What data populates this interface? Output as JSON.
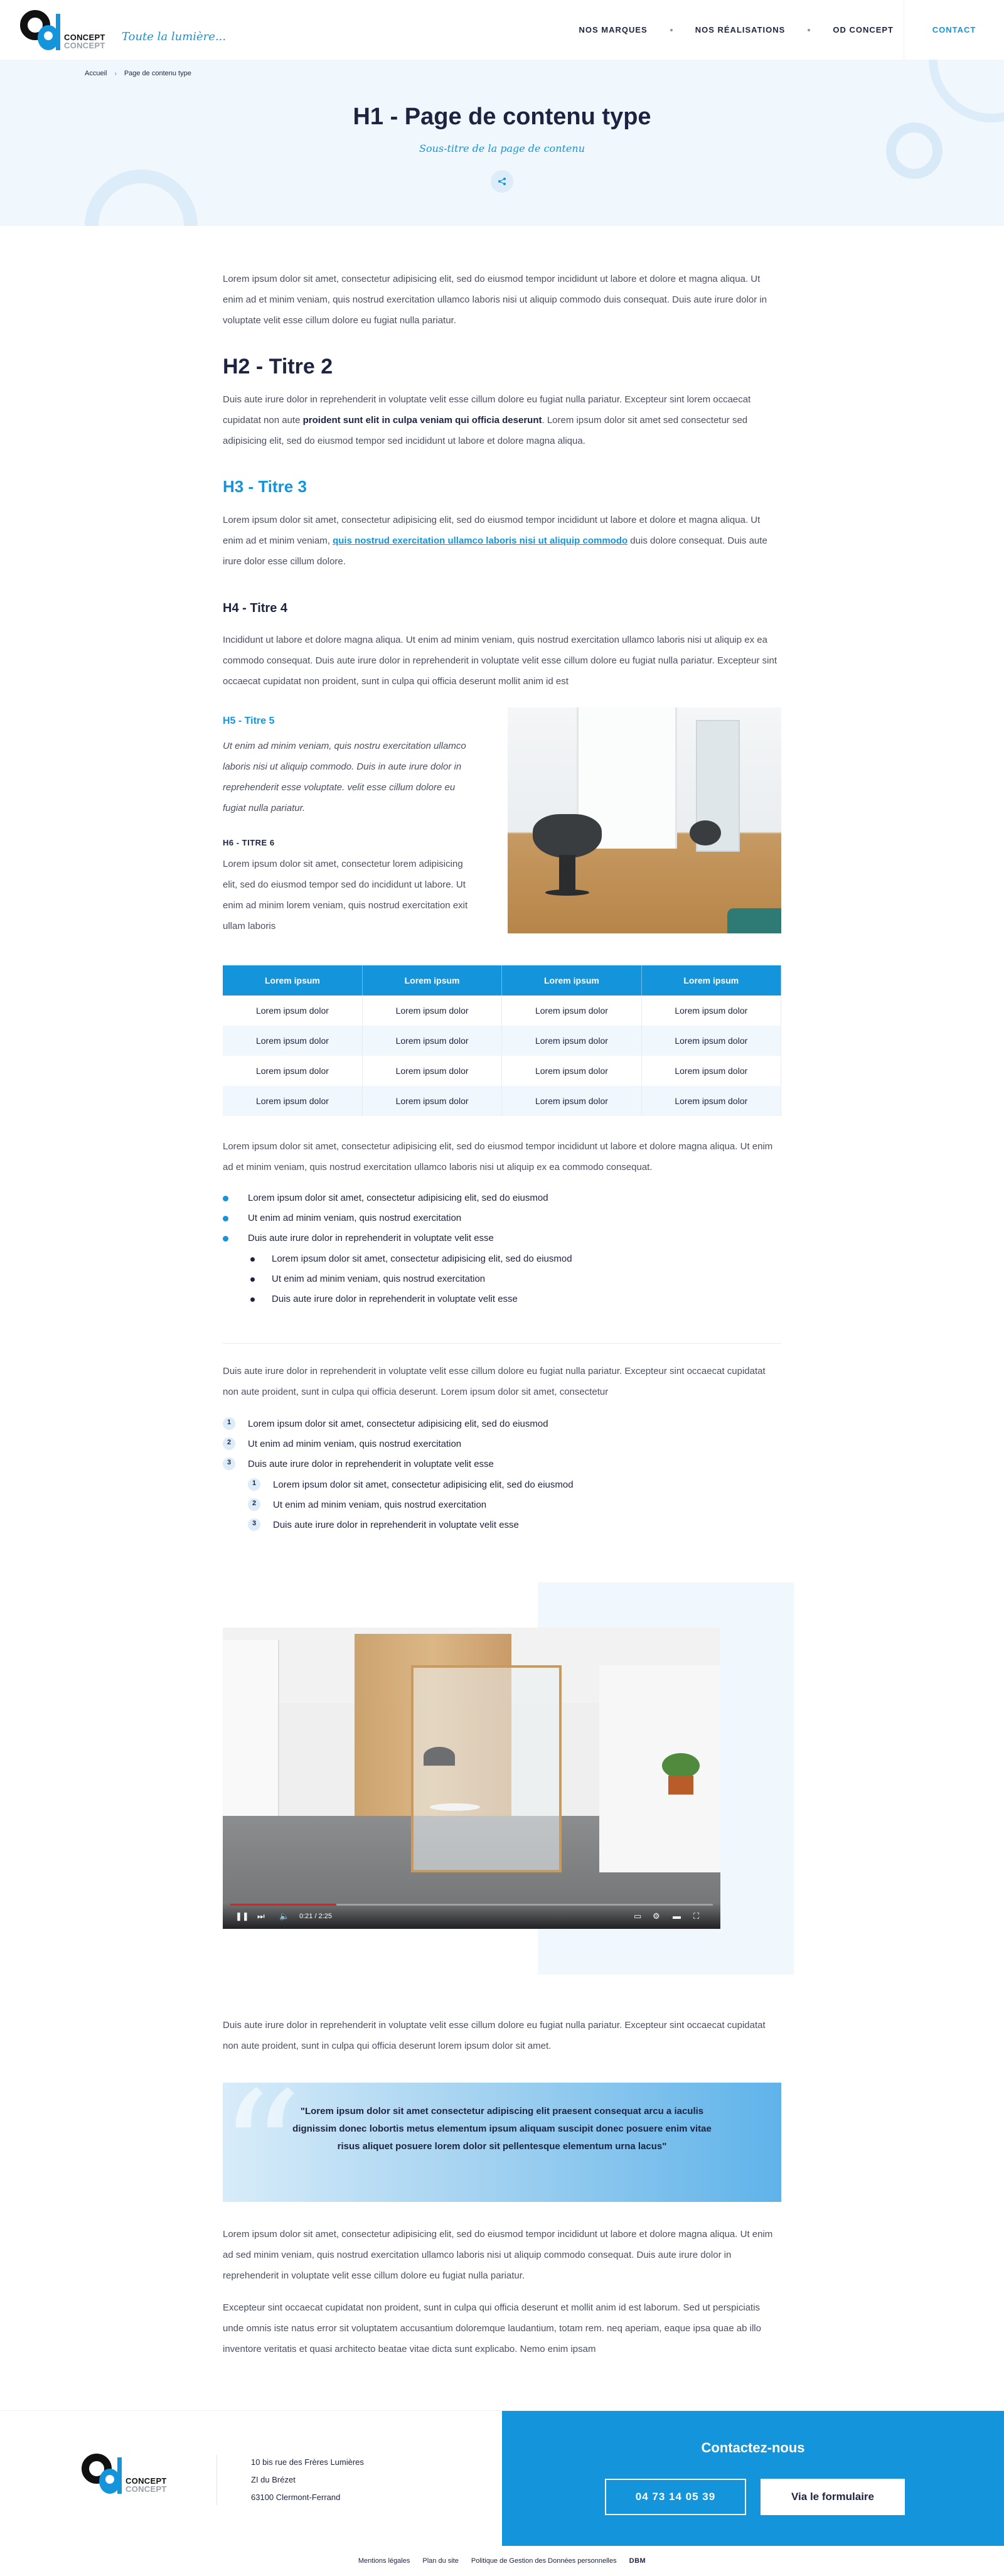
{
  "header": {
    "logo_word1": "CONCEPT",
    "logo_word2": "CONCEPT",
    "tagline": "Toute la lumière...",
    "nav": [
      "NOS MARQUES",
      "NOS RÉALISATIONS",
      "OD CONCEPT"
    ],
    "contact": "CONTACT"
  },
  "breadcrumb": [
    "Accueil",
    "Page de contenu type"
  ],
  "hero": {
    "title": "H1 - Page de contenu type",
    "subtitle": "Sous-titre de la page de contenu"
  },
  "content": {
    "intro": "Lorem ipsum dolor sit amet, consectetur adipisicing elit, sed do eiusmod tempor incididunt ut labore et dolore et magna aliqua. Ut enim ad et minim veniam, quis nostrud exercitation ullamco laboris nisi ut aliquip commodo duis consequat. Duis aute irure dolor in voluptate velit esse cillum dolore eu fugiat nulla pariatur.",
    "h2": "H2 - Titre 2",
    "p2_a": "Duis aute irure dolor in reprehenderit in voluptate velit esse cillum dolore eu fugiat nulla pariatur. Excepteur sint lorem occaecat cupidatat non aute ",
    "p2_bold": "proident sunt elit in culpa veniam qui officia deserunt",
    "p2_b": ". Lorem ipsum dolor sit amet sed consectetur sed adipisicing elit, sed do eiusmod tempor sed incididunt ut labore et dolore magna aliqua.",
    "h3": "H3 - Titre 3",
    "p3_a": "Lorem ipsum dolor sit amet, consectetur adipisicing elit, sed do eiusmod tempor incididunt ut labore et dolore et magna aliqua. Ut enim ad et minim veniam, ",
    "p3_link": "quis nostrud exercitation ullamco laboris nisi ut aliquip commodo",
    "p3_b": " duis dolore consequat. Duis aute irure dolor esse cillum dolore.",
    "h4": "H4 - Titre 4",
    "p4": "Incididunt ut labore et dolore magna aliqua. Ut enim ad minim veniam, quis nostrud exercitation ullamco laboris nisi ut aliquip ex ea commodo consequat. Duis aute irure dolor in reprehenderit in voluptate velit esse cillum dolore eu fugiat nulla pariatur. Excepteur sint occaecat cupidatat non proident, sunt in culpa qui officia deserunt mollit anim id est",
    "h5": "H5 - Titre 5",
    "p5": "Ut enim ad minim veniam, quis nostru exercitation ullamco laboris nisi ut aliquip commodo. Duis in aute irure dolor in reprehenderit esse voluptate. velit esse cillum dolore eu fugiat nulla pariatur.",
    "h6": "H6 - TITRE 6",
    "p6": "Lorem ipsum dolor sit amet, consectetur lorem adipisicing elit, sed do eiusmod tempor sed do incididunt ut labore. Ut enim ad minim lorem veniam, quis nostrud exercitation exit ullam laboris"
  },
  "table": {
    "headers": [
      "Lorem ipsum",
      "Lorem ipsum",
      "Lorem ipsum",
      "Lorem ipsum"
    ],
    "rows": [
      [
        "Lorem ipsum dolor",
        "Lorem ipsum dolor",
        "Lorem ipsum dolor",
        "Lorem ipsum dolor"
      ],
      [
        "Lorem ipsum dolor",
        "Lorem ipsum dolor",
        "Lorem ipsum dolor",
        "Lorem ipsum dolor"
      ],
      [
        "Lorem ipsum dolor",
        "Lorem ipsum dolor",
        "Lorem ipsum dolor",
        "Lorem ipsum dolor"
      ],
      [
        "Lorem ipsum dolor",
        "Lorem ipsum dolor",
        "Lorem ipsum dolor",
        "Lorem ipsum dolor"
      ]
    ]
  },
  "lists": {
    "ul_intro": "Lorem ipsum dolor sit amet, consectetur adipisicing elit, sed do eiusmod tempor incididunt ut labore et dolore magna aliqua. Ut enim ad et minim veniam, quis nostrud exercitation ullamco laboris nisi ut aliquip ex ea commodo consequat.",
    "ul": [
      "Lorem ipsum dolor sit amet, consectetur adipisicing elit, sed do eiusmod",
      "Ut enim ad minim veniam, quis nostrud exercitation",
      "Duis aute irure dolor in reprehenderit in voluptate velit esse"
    ],
    "ul_sub": [
      "Lorem ipsum dolor sit amet, consectetur adipisicing elit, sed do eiusmod",
      "Ut enim ad minim veniam, quis nostrud exercitation",
      "Duis aute irure dolor in reprehenderit in voluptate velit esse"
    ],
    "ol_intro": "Duis aute irure dolor in reprehenderit in voluptate velit esse cillum dolore eu fugiat nulla pariatur. Excepteur sint occaecat cupidatat non aute proident, sunt in culpa qui officia deserunt. Lorem ipsum dolor sit amet, consectetur",
    "ol": [
      "Lorem ipsum dolor sit amet, consectetur adipisicing elit, sed do eiusmod",
      "Ut enim ad minim veniam, quis nostrud exercitation",
      "Duis aute irure dolor in reprehenderit in voluptate velit esse"
    ],
    "ol_nums": [
      "1",
      "2",
      "3"
    ],
    "ol_sub": [
      "Lorem ipsum dolor sit amet, consectetur adipisicing elit, sed do eiusmod",
      "Ut enim ad minim veniam, quis nostrud exercitation",
      "Duis aute irure dolor in reprehenderit in voluptate velit esse"
    ]
  },
  "video": {
    "time": "0:21 / 2:25",
    "progress": 0.22
  },
  "after_video": "Duis aute irure dolor in reprehenderit in voluptate velit esse cillum dolore eu fugiat nulla pariatur. Excepteur sint occaecat cupidatat non aute proident, sunt in culpa qui officia deserunt lorem ipsum dolor sit amet.",
  "quote": "\"Lorem ipsum dolor sit amet consectetur adipiscing elit praesent consequat arcu a iaculis dignissim donec lobortis metus elementum ipsum aliquam suscipit donec posuere enim vitae risus aliquet posuere lorem dolor sit pellentesque elementum urna lacus\"",
  "closing": {
    "p1": "Lorem ipsum dolor sit amet, consectetur adipisicing elit, sed do eiusmod tempor incididunt ut labore et dolore magna aliqua. Ut enim ad sed minim veniam, quis nostrud exercitation ullamco laboris nisi ut aliquip commodo consequat. Duis aute irure dolor in reprehenderit in voluptate velit esse cillum dolore eu fugiat nulla pariatur.",
    "p2": "Excepteur sint occaecat cupidatat non proident, sunt in culpa qui officia deserunt et mollit anim id est laborum. Sed ut perspiciatis unde omnis iste natus error sit voluptatem accusantium doloremque laudantium, totam rem. neq aperiam, eaque ipsa quae ab illo inventore veritatis et quasi architecto beatae vitae dicta sunt explicabo. Nemo enim ipsam"
  },
  "footer": {
    "address": [
      "10 bis rue des Frères Lumières",
      "ZI du Brézet",
      "63100 Clermont-Ferrand"
    ],
    "contact_title": "Contactez-nous",
    "phone": "04 73 14 05 39",
    "form": "Via le formulaire",
    "legal": [
      "Mentions légales",
      "Plan du site",
      "Politique de Gestion des Données personnelles"
    ],
    "agency": "DBM"
  },
  "colors": {
    "accent": "#1495db",
    "navy": "#1d2340",
    "light_bg": "#f0f8fd"
  }
}
